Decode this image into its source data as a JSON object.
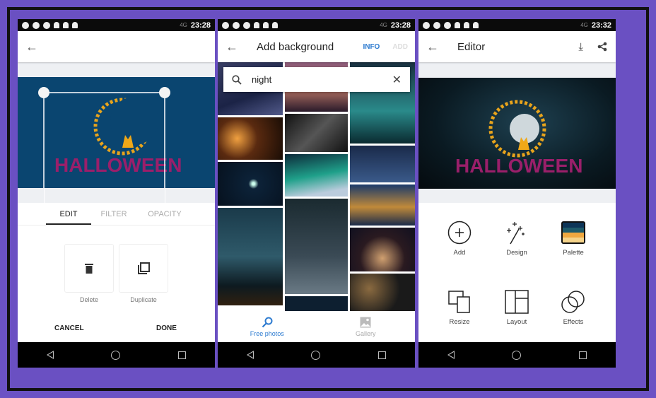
{
  "status_bar": [
    {
      "time": "23:28",
      "network": "4G"
    },
    {
      "time": "23:28",
      "network": "4G"
    },
    {
      "time": "23:32",
      "network": "4G"
    }
  ],
  "screen1": {
    "design_text": "HALLOWEEN",
    "tabs": [
      {
        "label": "EDIT",
        "active": true
      },
      {
        "label": "FILTER"
      },
      {
        "label": "OPACITY"
      }
    ],
    "actions": [
      {
        "label": "Delete",
        "icon": "trash-icon"
      },
      {
        "label": "Duplicate",
        "icon": "duplicate-icon"
      }
    ],
    "cancel_label": "CANCEL",
    "done_label": "DONE",
    "canvas_color": "#0a4570"
  },
  "screen2": {
    "title": "Add background",
    "info_label": "INFO",
    "add_label": "ADD",
    "search": {
      "value": "night"
    },
    "bottom_nav": [
      {
        "label": "Free photos",
        "active": true,
        "icon": "search-icon"
      },
      {
        "label": "Gallery",
        "icon": "image-icon"
      }
    ],
    "accent": "#2d7bd0"
  },
  "screen3": {
    "title": "Editor",
    "design_text": "HALLOWEEN",
    "tools": [
      {
        "label": "Add",
        "icon": "plus-circle-icon"
      },
      {
        "label": "Design",
        "icon": "magic-wand-icon"
      },
      {
        "label": "Palette",
        "icon": "palette-icon"
      },
      {
        "label": "Resize",
        "icon": "resize-icon"
      },
      {
        "label": "Layout",
        "icon": "layout-icon"
      },
      {
        "label": "Effects",
        "icon": "effects-icon"
      }
    ]
  }
}
